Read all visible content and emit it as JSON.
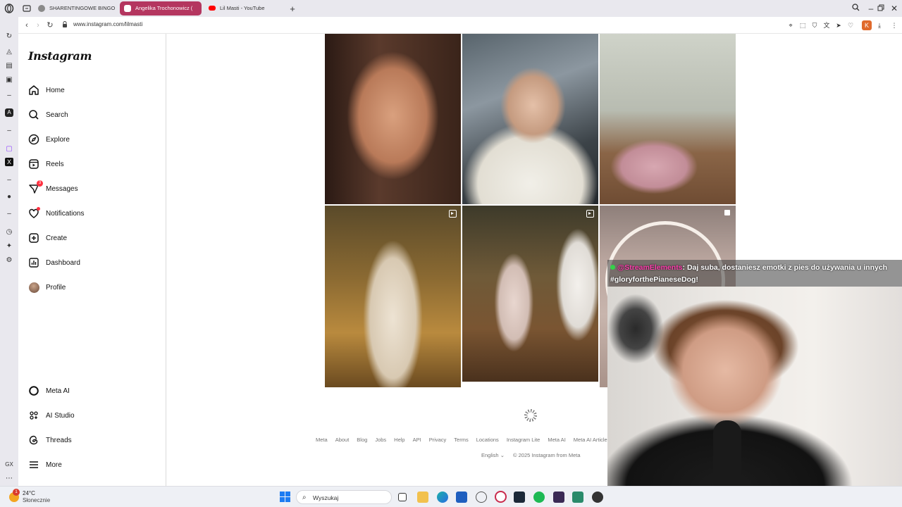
{
  "browser": {
    "tabs": [
      {
        "label": "SHARENTINGOWE BINGO",
        "favicon_color": "#7a7a7a",
        "active": false
      },
      {
        "label": "Angelika Trochonowicz (",
        "favicon_color": "#e1306c",
        "active": true
      },
      {
        "label": "Lil Masti - YouTube",
        "favicon_color": "#ff0000",
        "active": false
      }
    ],
    "new_tab_label": "+",
    "url": "www.instagram.com/lilmasti",
    "profile_initial": "K"
  },
  "instagram": {
    "logo": "Instagram",
    "nav": [
      {
        "label": "Home",
        "icon": "home-icon"
      },
      {
        "label": "Search",
        "icon": "search-icon"
      },
      {
        "label": "Explore",
        "icon": "compass-icon"
      },
      {
        "label": "Reels",
        "icon": "reels-icon"
      },
      {
        "label": "Messages",
        "icon": "messenger-icon",
        "badge": "3"
      },
      {
        "label": "Notifications",
        "icon": "heart-icon"
      },
      {
        "label": "Create",
        "icon": "plus-square-icon"
      },
      {
        "label": "Dashboard",
        "icon": "chart-icon"
      },
      {
        "label": "Profile",
        "icon": "avatar"
      }
    ],
    "bottom_nav": [
      {
        "label": "Meta AI",
        "icon": "meta-ai-icon"
      },
      {
        "label": "AI Studio",
        "icon": "ai-studio-icon"
      },
      {
        "label": "Threads",
        "icon": "threads-icon"
      },
      {
        "label": "More",
        "icon": "hamburger-icon"
      }
    ],
    "footer_links": [
      "Meta",
      "About",
      "Blog",
      "Jobs",
      "Help",
      "API",
      "Privacy",
      "Terms",
      "Locations",
      "Instagram Lite",
      "Meta AI",
      "Meta AI Articles"
    ],
    "language": "English",
    "copyright": "© 2025 Instagram from Meta"
  },
  "stream": {
    "chat_user": "@StreamElements",
    "chat_message": ": Daj suba, dostaniesz emotki z pies do używania u innych",
    "chat_message_2": "#gloryforthePianeseDog!"
  },
  "taskbar": {
    "weather_badge": "1",
    "temperature": "24°C",
    "condition": "Słonecznie",
    "search_label": "Wyszukaj"
  },
  "colors": {
    "active_tab": "#b4365f",
    "notification_red": "#ff3040",
    "windows_blue": "#1d7cf2"
  }
}
